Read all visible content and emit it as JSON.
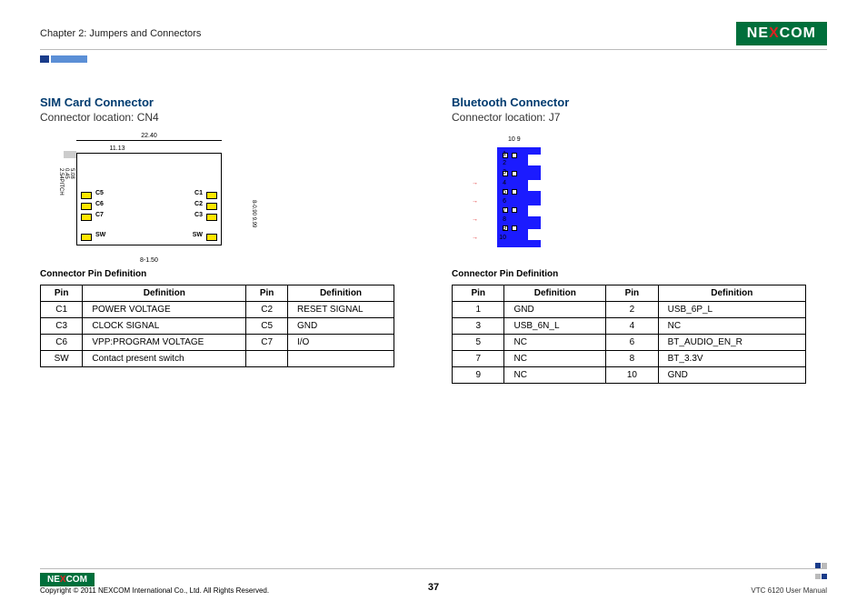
{
  "header": {
    "chapter": "Chapter 2: Jumpers and Connectors",
    "brand": "NEXCOM"
  },
  "left": {
    "title": "SIM Card Connector",
    "sub": "Connector location: CN4",
    "diagram": {
      "dim_top": "22.40",
      "dim_top2": "11.13",
      "dim_left": "5.08",
      "dim_left2": "2.54PITCH",
      "dim_left3": "0.45",
      "dim_right": "8-0.90",
      "dim_right2": "9.99",
      "dim_bot": "8-1.50",
      "labels": [
        "C5",
        "C6",
        "C7",
        "C1",
        "C2",
        "C3",
        "SW",
        "SW"
      ]
    },
    "table_title": "Connector Pin Definition",
    "headers": [
      "Pin",
      "Definition",
      "Pin",
      "Definition"
    ],
    "rows": [
      [
        "C1",
        "POWER VOLTAGE",
        "C2",
        "RESET SIGNAL"
      ],
      [
        "C3",
        "CLOCK SIGNAL",
        "C5",
        "GND"
      ],
      [
        "C6",
        "VPP:PROGRAM VOLTAGE",
        "C7",
        "I/O"
      ],
      [
        "SW",
        "Contact present switch",
        "",
        ""
      ]
    ]
  },
  "right": {
    "title": "Bluetooth Connector",
    "sub": "Connector location: J7",
    "diagram": {
      "top_nums": "10  9",
      "pin_nums": [
        "1",
        "2",
        "3",
        "4",
        "5",
        "6",
        "7",
        "8",
        "9",
        "10"
      ]
    },
    "table_title": "Connector Pin Definition",
    "headers": [
      "Pin",
      "Definition",
      "Pin",
      "Definition"
    ],
    "rows": [
      [
        "1",
        "GND",
        "2",
        "USB_6P_L"
      ],
      [
        "3",
        "USB_6N_L",
        "4",
        "NC"
      ],
      [
        "5",
        "NC",
        "6",
        "BT_AUDIO_EN_R"
      ],
      [
        "7",
        "NC",
        "8",
        "BT_3.3V"
      ],
      [
        "9",
        "NC",
        "10",
        "GND"
      ]
    ]
  },
  "footer": {
    "copyright": "Copyright © 2011 NEXCOM International Co., Ltd. All Rights Reserved.",
    "page": "37",
    "manual": "VTC 6120 User Manual"
  }
}
